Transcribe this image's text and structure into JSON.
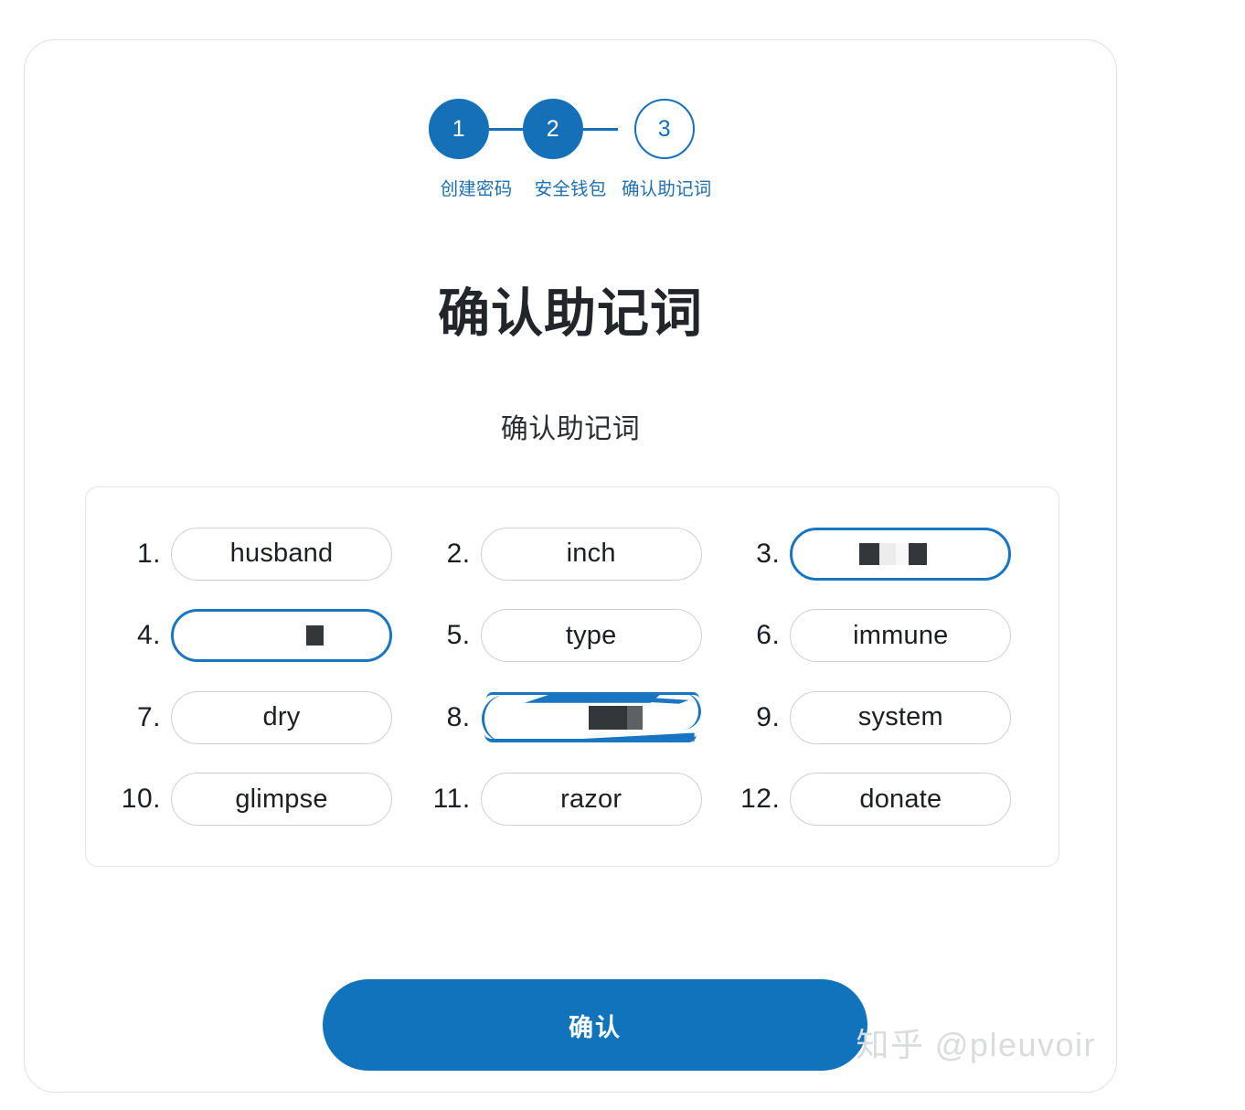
{
  "page": {
    "title": "确认助记词",
    "subtitle": "确认助记词",
    "accent_color": "#1273bd",
    "border_color": "#e0e0e0"
  },
  "stepper": {
    "steps": [
      {
        "number": "1",
        "label": "创建密码",
        "state": "done"
      },
      {
        "number": "2",
        "label": "安全钱包",
        "state": "done"
      },
      {
        "number": "3",
        "label": "确认助记词",
        "state": "current"
      }
    ]
  },
  "mnemonic": {
    "words": [
      {
        "index": "1.",
        "word": "husband",
        "state": "normal"
      },
      {
        "index": "2.",
        "word": "inch",
        "state": "normal"
      },
      {
        "index": "3.",
        "word": "",
        "state": "selected-redacted"
      },
      {
        "index": "4.",
        "word": "",
        "state": "selected-redacted"
      },
      {
        "index": "5.",
        "word": "type",
        "state": "normal"
      },
      {
        "index": "6.",
        "word": "immune",
        "state": "normal"
      },
      {
        "index": "7.",
        "word": "dry",
        "state": "normal"
      },
      {
        "index": "8.",
        "word": "",
        "state": "selected-redacted-glitch"
      },
      {
        "index": "9.",
        "word": "system",
        "state": "normal"
      },
      {
        "index": "10.",
        "word": "glimpse",
        "state": "normal"
      },
      {
        "index": "11.",
        "word": "razor",
        "state": "normal"
      },
      {
        "index": "12.",
        "word": "donate",
        "state": "normal"
      }
    ]
  },
  "actions": {
    "confirm_label": "确认"
  },
  "watermark": {
    "text": "知乎 @pleuvoir"
  }
}
